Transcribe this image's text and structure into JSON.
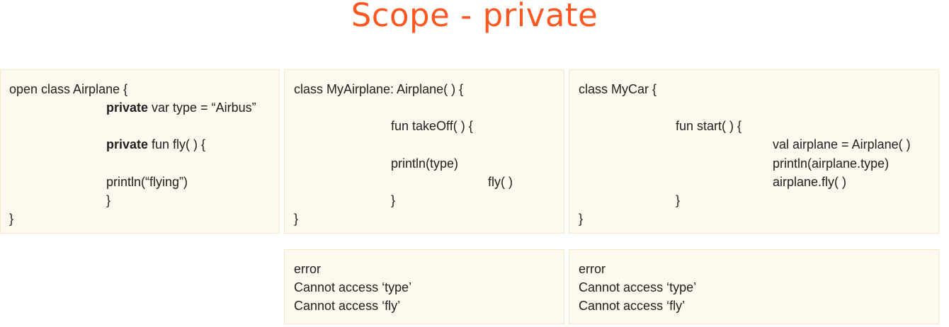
{
  "title": "Scope - private",
  "airplane": {
    "line1": "open class Airplane {",
    "private_kw": "private",
    "line2_rest": " var type = “Airbus”",
    "line3_rest": " fun fly( ) {",
    "line4": "println(“flying”)",
    "line5": "}",
    "line6": "}"
  },
  "myairplane": {
    "line1": "class MyAirplane: Airplane( ) {",
    "line2": "fun takeOff( ) {",
    "line3": "println(type)",
    "line4": "fly( )",
    "line5": "}",
    "line6": "}"
  },
  "mycar": {
    "line1": "class MyCar {",
    "line2": "fun start( ) {",
    "line3": "val airplane = Airplane( )",
    "line4": "println(airplane.type)",
    "line5": "airplane.fly( )",
    "line6": "}",
    "line7": "}"
  },
  "error_myairplane": {
    "line1": "error",
    "line2": "Cannot access ‘type’",
    "line3": "Cannot access ‘fly’"
  },
  "error_mycar": {
    "line1": "error",
    "line2": "Cannot access ‘type’",
    "line3": "Cannot access ‘fly’"
  }
}
